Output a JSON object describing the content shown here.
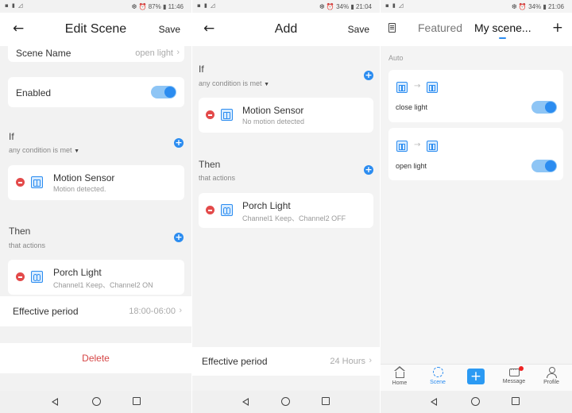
{
  "colors": {
    "accent": "#2b8cf0",
    "delete": "#d64545",
    "minus": "#e34a4a",
    "notification": "#e22222"
  },
  "phone1": {
    "status": {
      "right": "❆ ⏰ 87% ▮ 11:46"
    },
    "header": {
      "title": "Edit Scene",
      "save": "Save"
    },
    "scene_name": {
      "label": "Scene Name",
      "value": "open light"
    },
    "enabled": {
      "label": "Enabled",
      "on": true
    },
    "if": {
      "title": "If",
      "subtitle": "any condition is met"
    },
    "condition": {
      "name": "Motion Sensor",
      "detail": "Motion detected."
    },
    "then": {
      "title": "Then",
      "subtitle": "that actions"
    },
    "action": {
      "name": "Porch Light",
      "detail": "Channel1 Keep、Channel2 ON"
    },
    "effective_period": {
      "label": "Effective period",
      "value": "18:00-06:00"
    },
    "delete_label": "Delete"
  },
  "phone2": {
    "status": {
      "right": "❆ ⏰ 34% ▮ 21:04"
    },
    "header": {
      "title": "Add",
      "save": "Save"
    },
    "if": {
      "title": "If",
      "subtitle": "any condition is met"
    },
    "condition": {
      "name": "Motion Sensor",
      "detail": "No motion detected"
    },
    "then": {
      "title": "Then",
      "subtitle": "that actions"
    },
    "action": {
      "name": "Porch Light",
      "detail": "Channel1 Keep、Channel2 OFF"
    },
    "effective_period": {
      "label": "Effective period",
      "value": "24 Hours"
    }
  },
  "phone3": {
    "status": {
      "right": "❆ ⏰ 34% ▮ 21:06"
    },
    "tabs": {
      "featured": "Featured",
      "my_scenes": "My scene..."
    },
    "section": "Auto",
    "scenes": [
      {
        "name": "close light",
        "on": true
      },
      {
        "name": "open light",
        "on": true
      }
    ],
    "tabbar": {
      "home": "Home",
      "scene": "Scene",
      "message": "Message",
      "profile": "Profile"
    }
  }
}
